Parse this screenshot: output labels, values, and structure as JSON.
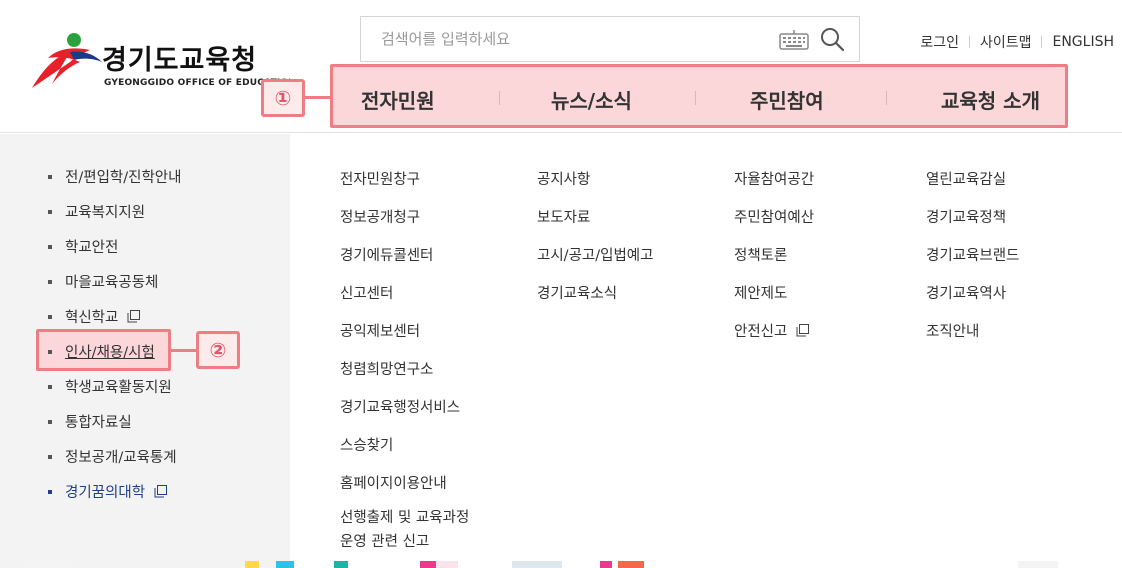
{
  "logo": {
    "title": "경기도교육청",
    "subtitle": "GYEONGGIDO OFFICE OF EDUCATION",
    "colors": {
      "red": "#e8202a",
      "blue": "#1b3a8c",
      "green": "#2aa33f"
    }
  },
  "search": {
    "placeholder": "검색어를 입력하세요",
    "keyboard_icon": "keyboard-icon",
    "search_icon": "search-icon"
  },
  "util_links": [
    "로그인",
    "사이트맵",
    "ENGLISH"
  ],
  "gnb": {
    "items": [
      "전자민원",
      "뉴스/소식",
      "주민참여",
      "교육청 소개"
    ],
    "highlight_color": "#fcd7da",
    "border_color": "#ef7d84"
  },
  "annotations": {
    "one": "①",
    "two": "②"
  },
  "sidebar": {
    "items": [
      {
        "label": "전/편입학/진학안내",
        "external": false
      },
      {
        "label": "교육복지지원",
        "external": false
      },
      {
        "label": "학교안전",
        "external": false
      },
      {
        "label": "마을교육공동체",
        "external": false
      },
      {
        "label": "혁신학교",
        "external": true
      },
      {
        "label": "인사/채용/시험",
        "external": false,
        "active": true
      },
      {
        "label": "학생교육활동지원",
        "external": false
      },
      {
        "label": "통합자료실",
        "external": false
      },
      {
        "label": "정보공개/교육통계",
        "external": false
      },
      {
        "label": "경기꿈의대학",
        "external": true,
        "accent": "#1f3f8a"
      }
    ]
  },
  "columns": [
    {
      "menu": "전자민원",
      "items": [
        [
          "전자민원창구"
        ],
        [
          "정보공개청구"
        ],
        [
          "경기에듀콜센터"
        ],
        [
          "신고센터"
        ],
        [
          "공익제보센터"
        ],
        [
          "청렴희망연구소"
        ],
        [
          "경기교육행정서비스"
        ],
        [
          "스승찾기"
        ],
        [
          "홈페이지이용안내"
        ],
        [
          "선행출제 및 교육과정",
          "운영 관련 신고"
        ]
      ]
    },
    {
      "menu": "뉴스/소식",
      "items": [
        [
          "공지사항"
        ],
        [
          "보도자료"
        ],
        [
          "고시/공고/입법예고"
        ],
        [
          "경기교육소식"
        ]
      ]
    },
    {
      "menu": "주민참여",
      "items": [
        [
          "자율참여공간"
        ],
        [
          "주민참여예산"
        ],
        [
          "정책토론"
        ],
        [
          "제안제도"
        ],
        [
          "안전신고"
        ]
      ],
      "external_index": 4
    },
    {
      "menu": "교육청 소개",
      "items": [
        [
          "열린교육감실"
        ],
        [
          "경기교육정책"
        ],
        [
          "경기교육브랜드"
        ],
        [
          "경기교육역사"
        ],
        [
          "조직안내"
        ]
      ]
    }
  ]
}
